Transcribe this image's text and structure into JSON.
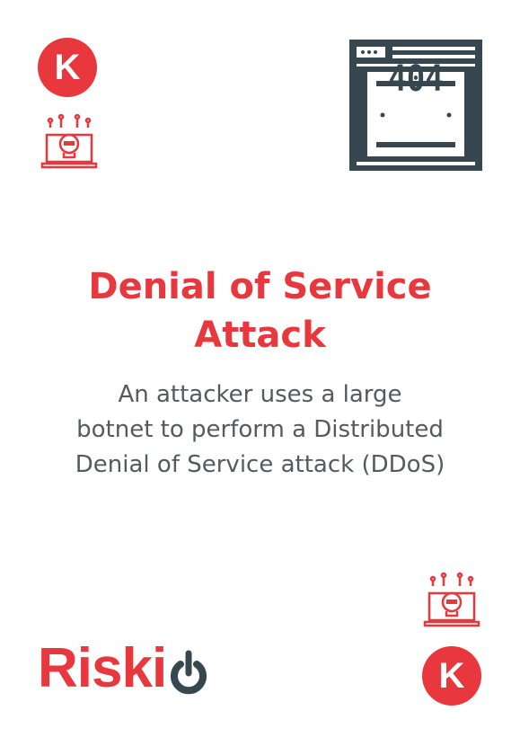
{
  "card": {
    "badge_letter": "K",
    "title_line1": "Denial of Service",
    "title_line2": "Attack",
    "description_line1": "An attacker uses a large",
    "description_line2": "botnet to perform a Distributed",
    "description_line3": "Denial of Service attack (DDoS)",
    "error_code": "404",
    "brand": "Riski",
    "colors": {
      "accent": "#e8383d",
      "dark": "#37474f"
    }
  }
}
